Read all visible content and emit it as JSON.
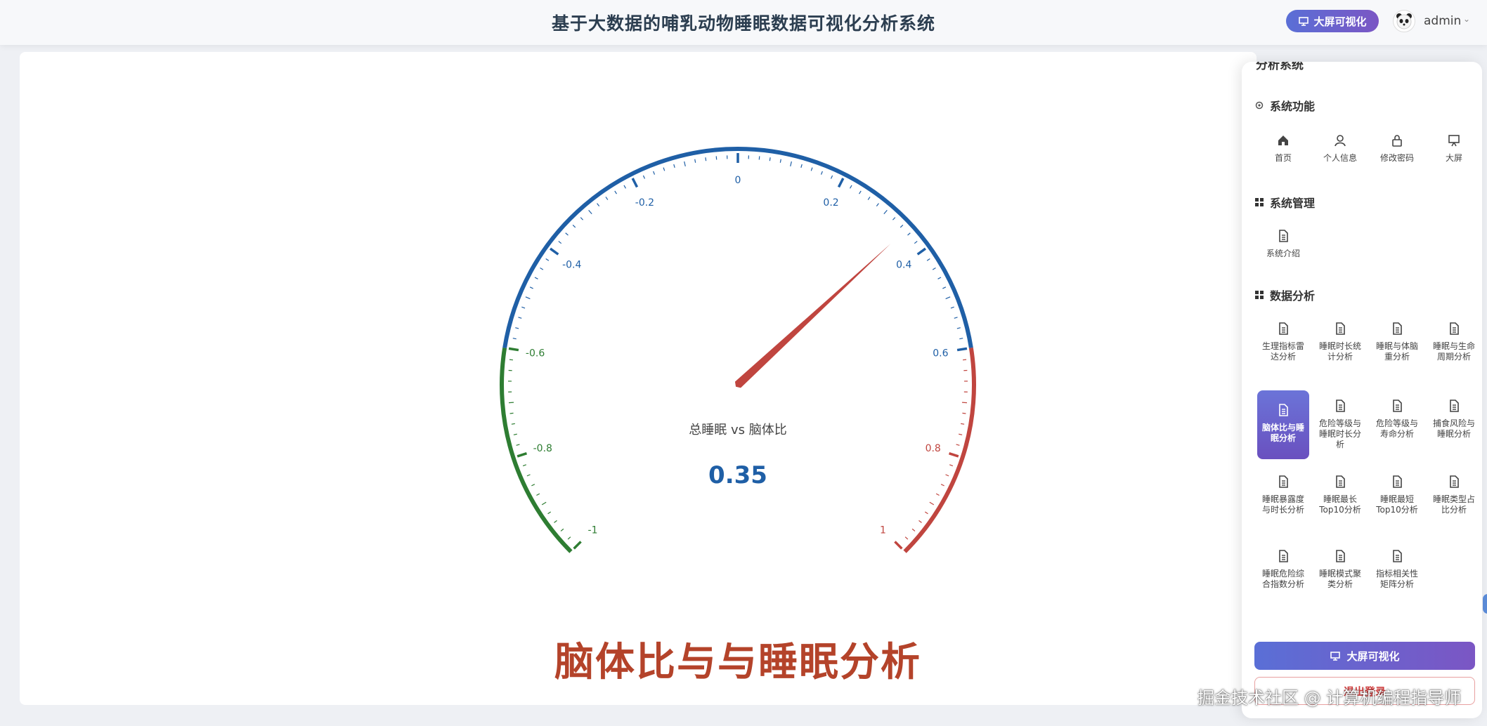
{
  "header": {
    "title": "基于大数据的哺乳动物睡眠数据可视化分析系统",
    "screen_button": "大屏可视化",
    "username": "admin"
  },
  "chart_data": {
    "type": "gauge",
    "value": 0.35,
    "value_label": "0.35",
    "series_name": "总睡眠 vs 脑体比",
    "min": -1,
    "max": 1,
    "tick_labels": [
      "-1",
      "-0.8",
      "-0.6",
      "-0.4",
      "-0.2",
      "0",
      "0.2",
      "0.4",
      "0.6",
      "0.8",
      "1"
    ],
    "bands": [
      {
        "to": -0.6,
        "color": "#2e7d32"
      },
      {
        "to": 0.6,
        "color": "#1f5fa6"
      },
      {
        "to": 1.0,
        "color": "#c0453f"
      }
    ],
    "pointer_color": "#c0453f",
    "value_color": "#1f5fa6"
  },
  "chart_heading": "脑体比与与睡眠分析",
  "panel": {
    "cut_title": "分析系统",
    "system_functions": {
      "title": "系统功能",
      "items": [
        {
          "label": "首页",
          "icon": "home-icon"
        },
        {
          "label": "个人信息",
          "icon": "user-icon"
        },
        {
          "label": "修改密码",
          "icon": "lock-icon"
        },
        {
          "label": "大屏",
          "icon": "screen-icon"
        }
      ]
    },
    "system_management": {
      "title": "系统管理",
      "items": [
        {
          "label": "系统介绍",
          "icon": "document-icon"
        }
      ]
    },
    "data_analysis": {
      "title": "数据分析",
      "items": [
        {
          "label": "生理指标雷达分析",
          "icon": "document-icon"
        },
        {
          "label": "睡眠时长统计分析",
          "icon": "document-icon"
        },
        {
          "label": "睡眠与体脑重分析",
          "icon": "document-icon"
        },
        {
          "label": "睡眠与生命周期分析",
          "icon": "document-icon"
        },
        {
          "label": "脑体比与睡眠分析",
          "icon": "document-icon",
          "active": true
        },
        {
          "label": "危险等级与睡眠时长分析",
          "icon": "document-icon"
        },
        {
          "label": "危险等级与寿命分析",
          "icon": "document-icon"
        },
        {
          "label": "捕食风险与睡眠分析",
          "icon": "document-icon"
        },
        {
          "label": "睡眠暴露度与时长分析",
          "icon": "document-icon"
        },
        {
          "label": "睡眠最长Top10分析",
          "icon": "document-icon"
        },
        {
          "label": "睡眠最短Top10分析",
          "icon": "document-icon"
        },
        {
          "label": "睡眠类型占比分析",
          "icon": "document-icon"
        },
        {
          "label": "睡眠危险综合指数分析",
          "icon": "document-icon"
        },
        {
          "label": "睡眠模式聚类分析",
          "icon": "document-icon"
        },
        {
          "label": "指标相关性矩阵分析",
          "icon": "document-icon"
        }
      ]
    },
    "screen_button": "大屏可视化",
    "exit_button": "退出登录"
  },
  "watermark": "掘金技术社区 @ 计算机编程指导师"
}
